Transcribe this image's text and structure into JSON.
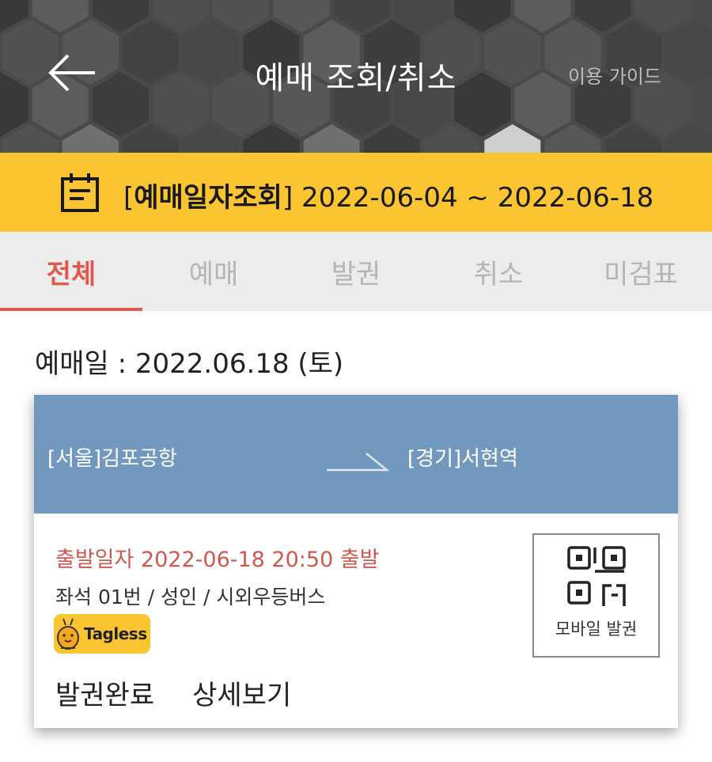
{
  "header": {
    "title": "예매 조회/취소",
    "guide_label": "이용 가이드",
    "back_icon": "arrow-left-icon"
  },
  "date_range": {
    "prefix": "[",
    "label": "예매일자조회",
    "suffix": "]",
    "range": "2022-06-04 ~ 2022-06-18",
    "icon": "calendar-icon"
  },
  "tabs": [
    {
      "label": "전체",
      "active": true
    },
    {
      "label": "예매",
      "active": false
    },
    {
      "label": "발권",
      "active": false
    },
    {
      "label": "취소",
      "active": false
    },
    {
      "label": "미검표",
      "active": false
    }
  ],
  "reservation": {
    "date_line": "예매일 : 2022.06.18 (토)",
    "from": "[서울]김포공항",
    "to": "[경기]서현역",
    "departure": "출발일자 2022-06-18 20:50 출발",
    "seat_info": "좌석 01번 / 성인 / 시외우등버스",
    "badge": "Tagless",
    "mobile_ticket_label": "모바일 발권",
    "status_label": "발권완료",
    "detail_label": "상세보기"
  },
  "colors": {
    "accent_red": "#e3584e",
    "date_bar_yellow": "#fbc531",
    "route_blue": "#7299bd"
  }
}
